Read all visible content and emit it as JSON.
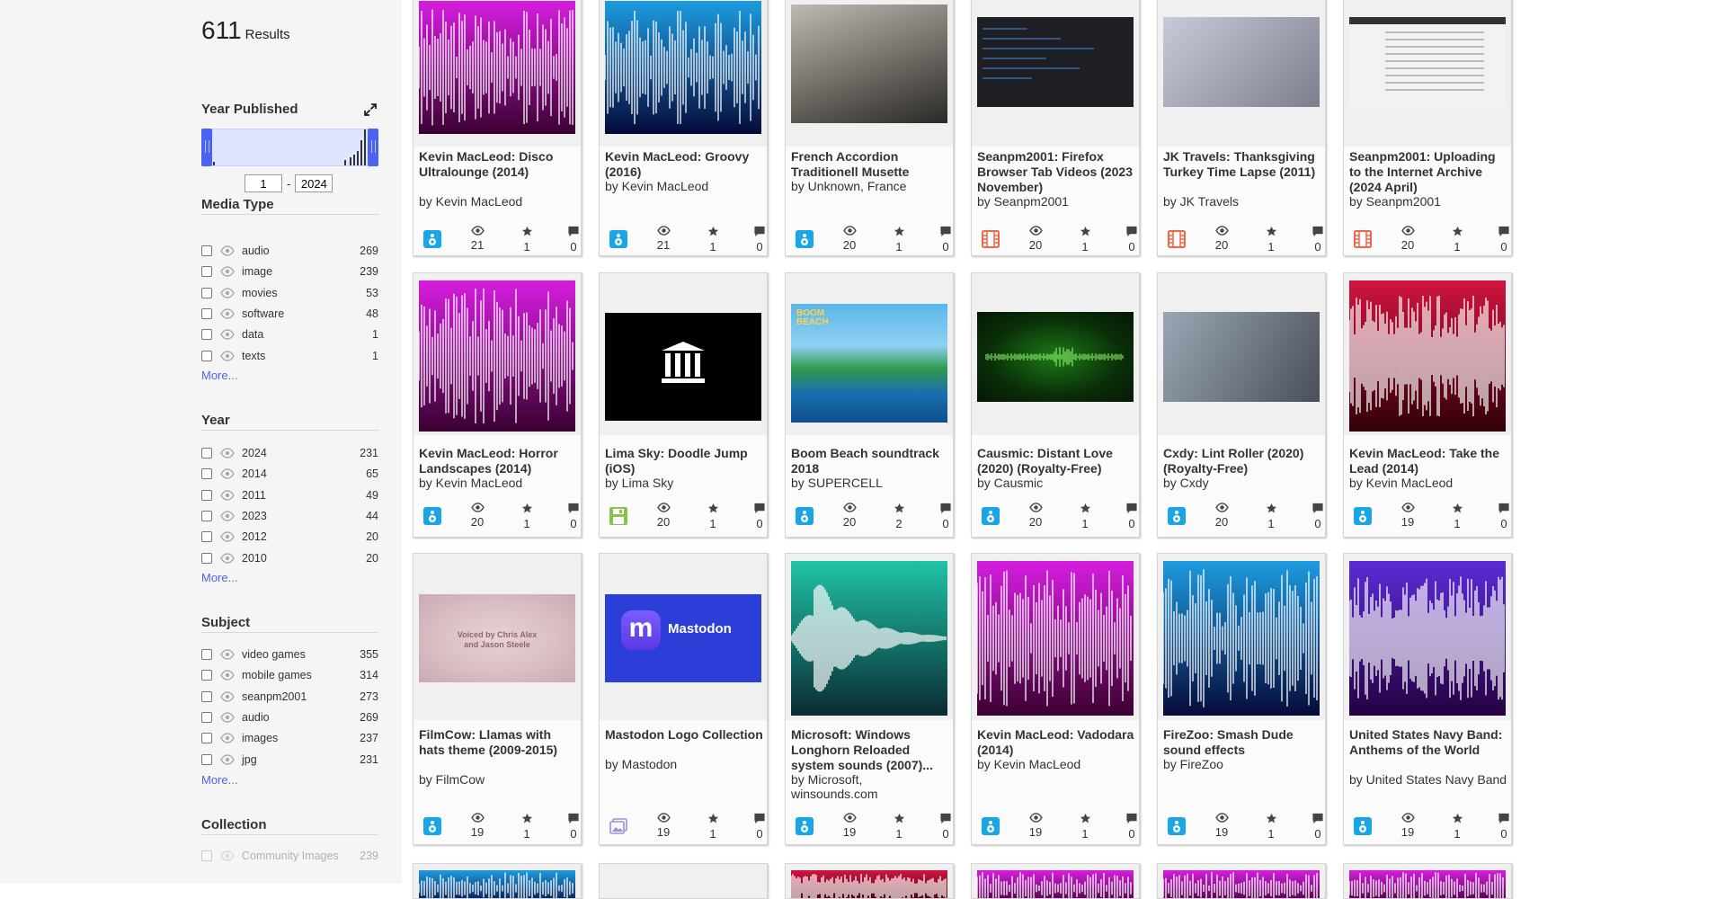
{
  "results": {
    "count": "611",
    "label": "Results"
  },
  "year_published": {
    "title": "Year Published",
    "from": "1",
    "to": "2024"
  },
  "facets": [
    {
      "title": "Media Type",
      "items": [
        {
          "label": "audio",
          "count": "269"
        },
        {
          "label": "image",
          "count": "239"
        },
        {
          "label": "movies",
          "count": "53"
        },
        {
          "label": "software",
          "count": "48"
        },
        {
          "label": "data",
          "count": "1"
        },
        {
          "label": "texts",
          "count": "1"
        }
      ],
      "more": "More..."
    },
    {
      "title": "Year",
      "items": [
        {
          "label": "2024",
          "count": "231"
        },
        {
          "label": "2014",
          "count": "65"
        },
        {
          "label": "2011",
          "count": "49"
        },
        {
          "label": "2023",
          "count": "44"
        },
        {
          "label": "2012",
          "count": "20"
        },
        {
          "label": "2010",
          "count": "20"
        }
      ],
      "more": "More..."
    },
    {
      "title": "Subject",
      "items": [
        {
          "label": "video games",
          "count": "355"
        },
        {
          "label": "mobile games",
          "count": "314"
        },
        {
          "label": "seanpm2001",
          "count": "273"
        },
        {
          "label": "audio",
          "count": "269"
        },
        {
          "label": "images",
          "count": "237"
        },
        {
          "label": "jpg",
          "count": "231"
        }
      ],
      "more": "More..."
    },
    {
      "title": "Collection",
      "items": [
        {
          "label": "Community Images",
          "count": "239"
        }
      ],
      "more": ""
    }
  ],
  "cards": [
    {
      "title": "Kevin MacLeod: Disco Ultralounge (2014)",
      "by": "by Kevin MacLeod",
      "type": "audio",
      "views": "21",
      "favs": "1",
      "reviews": "0",
      "art": "wave-magenta"
    },
    {
      "title": "Kevin MacLeod: Groovy (2016)",
      "by": "by Kevin MacLeod",
      "type": "audio",
      "views": "21",
      "favs": "1",
      "reviews": "0",
      "art": "wave-blue"
    },
    {
      "title": "French Accordion Traditionell Musette",
      "by": "by Unknown, France",
      "type": "audio",
      "views": "20",
      "favs": "1",
      "reviews": "0",
      "art": "accordion-photo"
    },
    {
      "title": "Seanpm2001: Firefox Browser Tab Videos (2023 November)",
      "by": "by Seanpm2001",
      "type": "movies",
      "views": "20",
      "favs": "1",
      "reviews": "0",
      "art": "dark-screen"
    },
    {
      "title": "JK Travels: Thanksgiving Turkey Time Lapse (2011)",
      "by": "by JK Travels",
      "type": "movies",
      "views": "20",
      "favs": "1",
      "reviews": "0",
      "art": "turkey-photo"
    },
    {
      "title": "Seanpm2001: Uploading to the Internet Archive (2024 April)",
      "by": "by Seanpm2001",
      "type": "movies",
      "views": "20",
      "favs": "1",
      "reviews": "0",
      "art": "light-screen"
    },
    {
      "title": "Kevin MacLeod: Horror Landscapes (2014)",
      "by": "by Kevin MacLeod",
      "type": "audio",
      "views": "20",
      "favs": "1",
      "reviews": "0",
      "art": "wave-magenta"
    },
    {
      "title": "Lima Sky: Doodle Jump (iOS)",
      "by": "by Lima Sky",
      "type": "software",
      "views": "20",
      "favs": "1",
      "reviews": "0",
      "art": "archive-logo"
    },
    {
      "title": "Boom Beach soundtrack 2018",
      "by": "by SUPERCELL",
      "type": "audio",
      "views": "20",
      "favs": "2",
      "reviews": "0",
      "art": "boom-beach",
      "thumb_text": "BOOM BEACH"
    },
    {
      "title": "Causmic: Distant Love (2020) (Royalty-Free)",
      "by": "by Causmic",
      "type": "audio",
      "views": "20",
      "favs": "1",
      "reviews": "0",
      "art": "green-wave"
    },
    {
      "title": "Cxdy: Lint Roller (2020) (Royalty-Free)",
      "by": "by Cxdy",
      "type": "audio",
      "views": "20",
      "favs": "1",
      "reviews": "0",
      "art": "robot-art"
    },
    {
      "title": "Kevin MacLeod: Take the Lead (2014)",
      "by": "by Kevin MacLeod",
      "type": "audio",
      "views": "19",
      "favs": "1",
      "reviews": "0",
      "art": "wave-red"
    },
    {
      "title": "FilmCow: Llamas with hats theme (2009-2015)",
      "by": "by FilmCow",
      "type": "audio",
      "views": "19",
      "favs": "1",
      "reviews": "0",
      "art": "pink-texture",
      "thumb_text": "Voiced by Chris Alex and Jason Steele"
    },
    {
      "title": "Mastodon Logo Collection",
      "by": "by Mastodon",
      "type": "image",
      "views": "19",
      "favs": "1",
      "reviews": "0",
      "art": "mastodon",
      "thumb_text": "Mastodon"
    },
    {
      "title": "Microsoft: Windows Longhorn Reloaded system sounds (2007)...",
      "by": "by Microsoft, winsounds.com",
      "type": "audio",
      "views": "19",
      "favs": "1",
      "reviews": "0",
      "art": "wave-teal"
    },
    {
      "title": "Kevin MacLeod: Vadodara (2014)",
      "by": "by Kevin MacLeod",
      "type": "audio",
      "views": "19",
      "favs": "1",
      "reviews": "0",
      "art": "wave-magenta"
    },
    {
      "title": "FireZoo: Smash Dude sound effects",
      "by": "by FireZoo",
      "type": "audio",
      "views": "19",
      "favs": "1",
      "reviews": "0",
      "art": "wave-blue"
    },
    {
      "title": "United States Navy Band: Anthems of the World",
      "by": "by United States Navy Band",
      "type": "audio",
      "views": "19",
      "favs": "1",
      "reviews": "0",
      "art": "wave-purple"
    }
  ],
  "partial_row": [
    "wave-blue",
    "blank",
    "wave-red",
    "wave-magenta",
    "wave-magenta",
    "wave-magenta"
  ]
}
